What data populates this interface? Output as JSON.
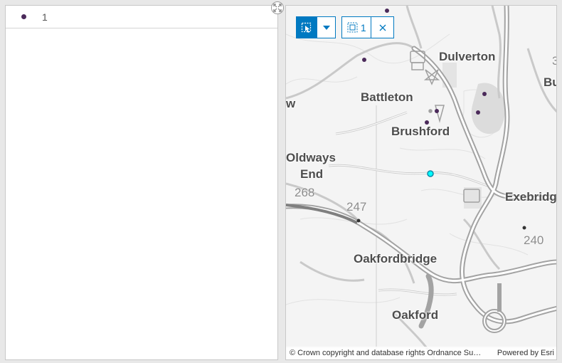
{
  "list": {
    "items": [
      {
        "label": "1",
        "color": "#4b2a5a"
      }
    ]
  },
  "expand": {
    "icon": "expand-icon"
  },
  "toolbar": {
    "select_icon": "select-by-rectangle-icon",
    "dropdown_icon": "chevron-down-icon",
    "selection_icon": "selection-rectangle-icon",
    "selection_count": "1",
    "clear_icon": "close-icon",
    "accent": "#0079c1"
  },
  "map": {
    "places": {
      "dulverton": "Dulverton",
      "battleton": "Battleton",
      "brushford": "Brushford",
      "oldways": "Oldways",
      "end": "End",
      "exebridge": "Exebridg",
      "oakfordbridge": "Oakfordbridge",
      "oakford": "Oakford",
      "bu": "Bu",
      "w": "w"
    },
    "spot_heights": {
      "h268": "268",
      "h247": "247",
      "h240": "240",
      "h3": "3"
    },
    "feature_color": "#4b2a5a",
    "selected_color": "#00b4d8",
    "attribution": "© Crown copyright and database rights Ordnance Survey",
    "powered_by": "Powered by Esri"
  }
}
